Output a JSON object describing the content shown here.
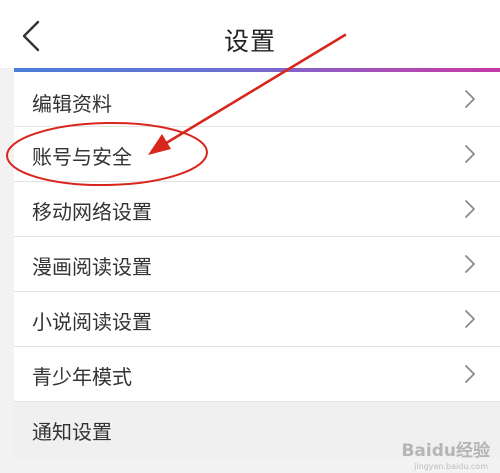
{
  "header": {
    "title": "设置",
    "back_icon": "chevron-left-icon"
  },
  "settings": {
    "items": [
      {
        "label": "编辑资料",
        "icon": "chevron-right-icon"
      },
      {
        "label": "账号与安全",
        "icon": "chevron-right-icon",
        "highlighted": true
      },
      {
        "label": "移动网络设置",
        "icon": "chevron-right-icon"
      },
      {
        "label": "漫画阅读设置",
        "icon": "chevron-right-icon"
      },
      {
        "label": "小说阅读设置",
        "icon": "chevron-right-icon"
      },
      {
        "label": "青少年模式",
        "icon": "chevron-right-icon"
      },
      {
        "label": "通知设置"
      }
    ]
  },
  "annotation": {
    "color": "#d9261c"
  },
  "watermark": {
    "text": "Baidu经验",
    "sub": "jingyan.baidu.com"
  },
  "colors": {
    "gradient_start": "#4a7fd6",
    "gradient_end": "#c43aa6",
    "annotation": "#d9261c"
  }
}
